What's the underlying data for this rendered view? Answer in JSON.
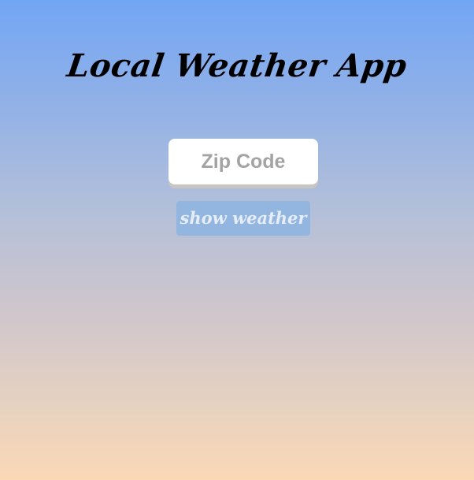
{
  "app": {
    "title": "Local Weather App"
  },
  "form": {
    "zip_placeholder": "Zip Code",
    "zip_value": "",
    "submit_label": "show weather"
  },
  "colors": {
    "gradient_top": "#72a6f4",
    "gradient_bottom": "#fbd8b6",
    "button_bg": "#93b6e0",
    "button_text": "#e6edf5",
    "input_bg": "#ffffff",
    "placeholder": "#a3a3a3"
  }
}
